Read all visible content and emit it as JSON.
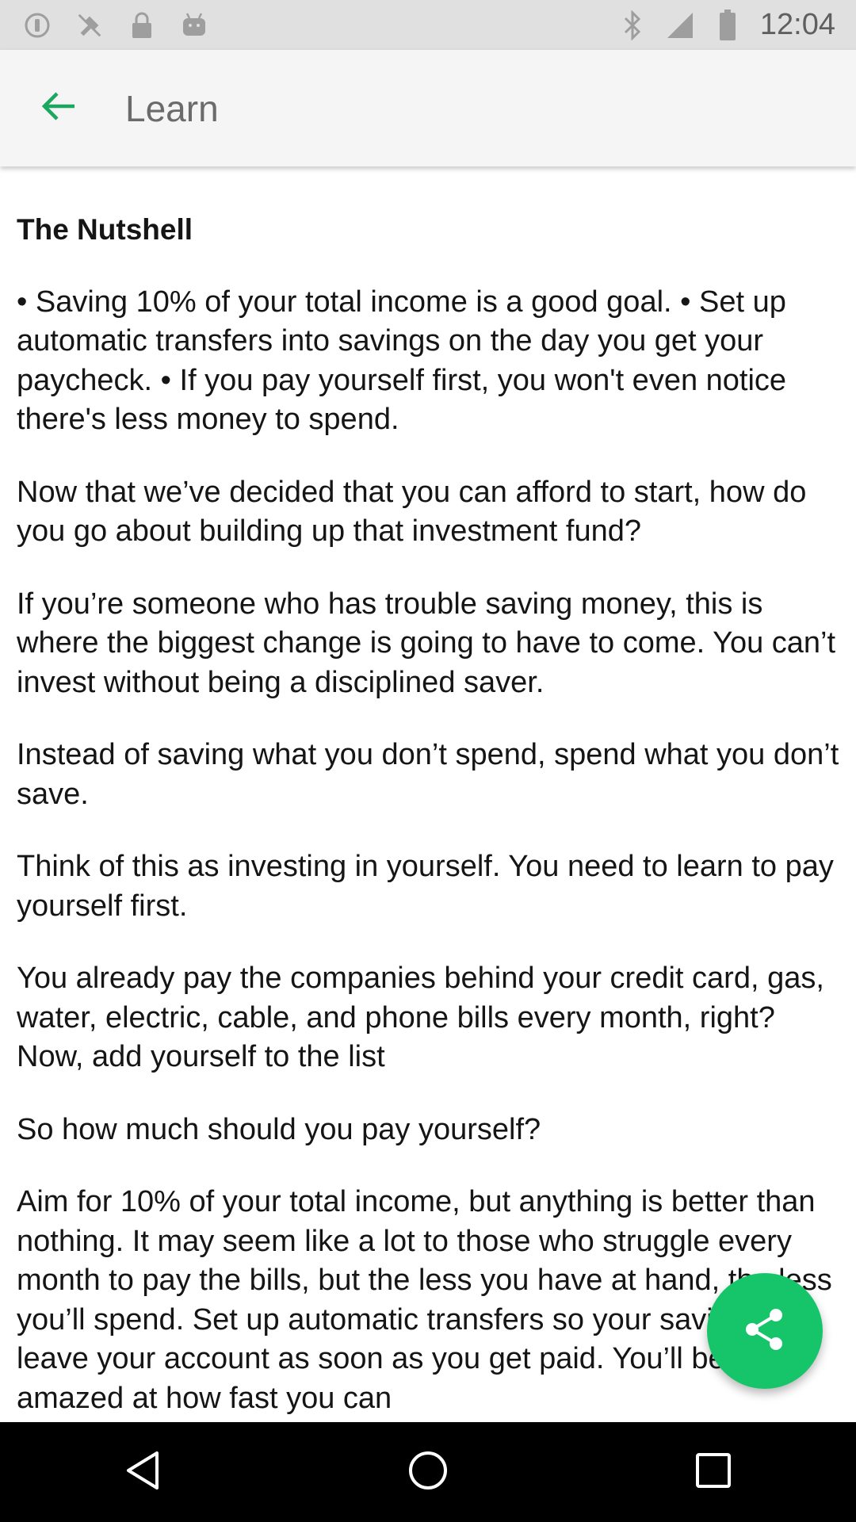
{
  "status_bar": {
    "time": "12:04",
    "left_icons": [
      "alert-icon",
      "no-sim-icon",
      "lock-icon",
      "android-icon"
    ],
    "right_icons": [
      "bluetooth-icon",
      "signal-icon",
      "battery-icon"
    ]
  },
  "app_bar": {
    "title": "Learn",
    "back_icon": "arrow-back-icon",
    "accent_color": "#1aa860"
  },
  "article": {
    "heading": "The Nutshell",
    "paragraphs": [
      "• Saving 10% of your total income is a good goal. • Set up automatic transfers into savings on the day you get your paycheck. • If you pay yourself first, you won't even notice there's less money to spend.",
      "Now that we’ve decided that you can afford to start, how do you go about building up that investment fund?",
      "If you’re someone who has trouble saving money, this is where the biggest change is going to have to come. You can’t invest without being a disciplined saver.",
      "Instead of saving what you don’t spend, spend what you don’t save.",
      "Think of this as investing in yourself. You need to learn to pay yourself first.",
      "You already pay the companies behind your credit card, gas, water, electric, cable, and phone bills every month, right? Now, add yourself to the list",
      "So how much should you pay yourself?",
      "Aim for 10% of your total income, but anything is better than nothing. It may seem like a lot to those who struggle every month to pay the bills, but the less you have at hand, the less you’ll spend. Set up automatic transfers so your savings leave your account as soon as you get paid. You’ll be amazed at how fast you can"
    ]
  },
  "fab": {
    "icon": "share-icon",
    "color": "#16c56a"
  },
  "nav_bar": {
    "icons": [
      "back-triangle-icon",
      "home-circle-icon",
      "recents-square-icon"
    ]
  }
}
